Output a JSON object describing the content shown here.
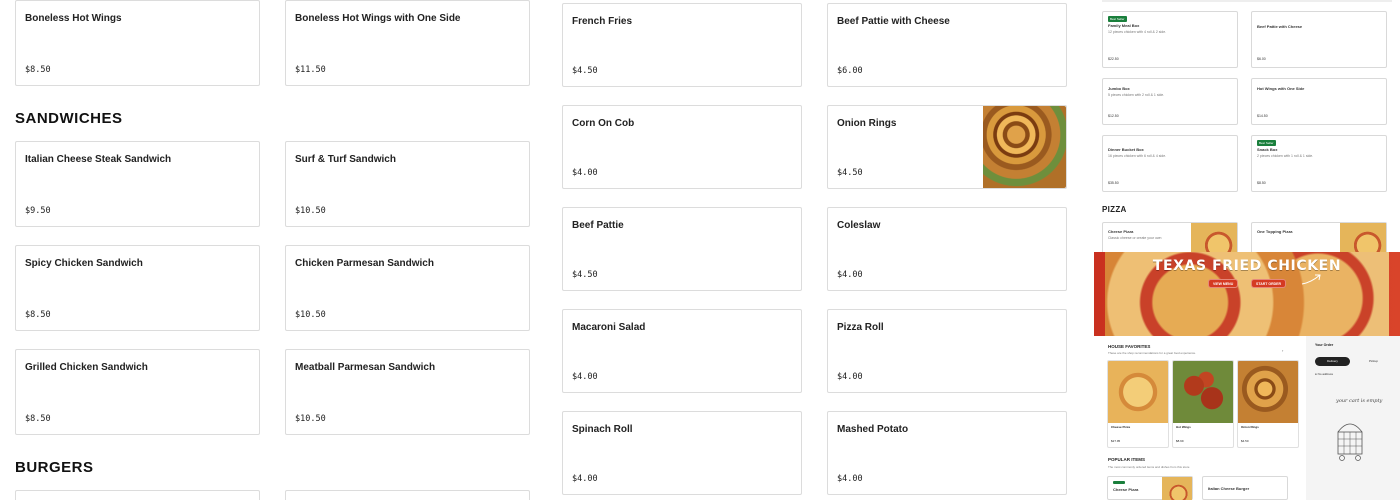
{
  "wings": [
    {
      "name": "Boneless Hot Wings",
      "price": "$8.50"
    },
    {
      "name": "Boneless Hot Wings with One Side",
      "price": "$11.50"
    }
  ],
  "sections": {
    "sandwiches": "SANDWICHES",
    "burgers": "BURGERS"
  },
  "sandwiches": [
    {
      "name": "Italian Cheese Steak Sandwich",
      "price": "$9.50"
    },
    {
      "name": "Surf & Turf Sandwich",
      "price": "$10.50"
    },
    {
      "name": "Spicy Chicken Sandwich",
      "price": "$8.50"
    },
    {
      "name": "Chicken Parmesan Sandwich",
      "price": "$10.50"
    },
    {
      "name": "Grilled Chicken Sandwich",
      "price": "$8.50"
    },
    {
      "name": "Meatball Parmesan Sandwich",
      "price": "$10.50"
    }
  ],
  "sides": [
    {
      "name": "French Fries",
      "price": "$4.50"
    },
    {
      "name": "Beef Pattie with Cheese",
      "price": "$6.00"
    },
    {
      "name": "Corn On Cob",
      "price": "$4.00"
    },
    {
      "name": "Onion Rings",
      "price": "$4.50"
    },
    {
      "name": "Beef Pattie",
      "price": "$4.50"
    },
    {
      "name": "Coleslaw",
      "price": "$4.00"
    },
    {
      "name": "Macaroni Salad",
      "price": "$4.00"
    },
    {
      "name": "Pizza Roll",
      "price": "$4.00"
    },
    {
      "name": "Spinach Roll",
      "price": "$4.00"
    },
    {
      "name": "Mashed Potato",
      "price": "$4.00"
    }
  ],
  "preview": {
    "cards": [
      {
        "badge": "Best Seller",
        "title": "Family Meal Box",
        "desc": "12 pieces chicken with 4 roll & 2 side.",
        "price": "$22.50"
      },
      {
        "badge": "",
        "title": "Beef Pattie with Cheese",
        "desc": "",
        "price": "$6.00"
      },
      {
        "badge": "",
        "title": "Jumbo Box",
        "desc": "5 pieces chicken with 2 roll & 1 side.",
        "price": "$12.50"
      },
      {
        "badge": "",
        "title": "Hot Wings with One Side",
        "desc": "",
        "price": "$14.50"
      },
      {
        "badge": "",
        "title": "Dinner Bucket Box",
        "desc": "16 pieces chicken with 6 roll & 4 side.",
        "price": "$35.50"
      },
      {
        "badge": "Best Seller",
        "title": "Snack Box",
        "desc": "2 pieces chicken with 1 roll & 1 side.",
        "price": "$8.50"
      }
    ],
    "pizza_heading": "PIZZA",
    "pizza_cards": [
      {
        "title": "Cheese Pizza",
        "desc": "Classic cheese or create your own"
      },
      {
        "title": "One Topping Pizza",
        "desc": ""
      }
    ],
    "hero_title": "TEXAS FRIED CHICKEN",
    "hero_view_menu": "VIEW MENU",
    "hero_start_order": "START ORDER",
    "fav_title": "HOUSE FAVORITES",
    "fav_sub": "These are the shop recommendations for a great food experience.",
    "fav_items": [
      {
        "title": "Cheese Pizza",
        "price": "$27.95"
      },
      {
        "title": "Hot Wings",
        "price": "$8.99"
      },
      {
        "title": "Onion Rings",
        "price": "$4.50"
      }
    ],
    "popular_title": "POPULAR ITEMS",
    "popular_sub": "The most commonly ordered items and dishes from this store",
    "popular_items": [
      {
        "title": "Cheese Pizza"
      },
      {
        "title": "Italian Cheese Burger"
      }
    ],
    "order_title": "Your Order",
    "order_delivery": "Delivery",
    "order_pickup": "Pickup",
    "order_address": "No address",
    "order_empty": "your cart is empty"
  }
}
